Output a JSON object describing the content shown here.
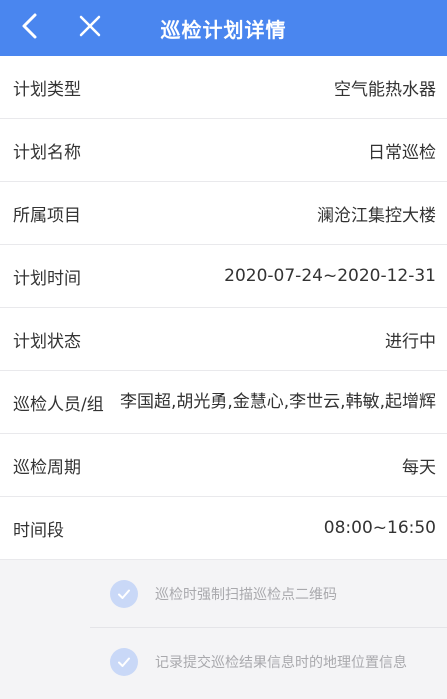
{
  "header": {
    "title": "巡检计划详情",
    "back_icon": "chevron-left-icon",
    "close_icon": "close-icon",
    "bg_color": "#4a86ef"
  },
  "details": [
    {
      "label": "计划类型",
      "value": "空气能热水器"
    },
    {
      "label": "计划名称",
      "value": "日常巡检"
    },
    {
      "label": "所属项目",
      "value": "澜沧江集控大楼"
    },
    {
      "label": "计划时间",
      "value": "2020-07-24~2020-12-31"
    },
    {
      "label": "计划状态",
      "value": "进行中"
    },
    {
      "label": "巡检人员/组",
      "value": "李国超,胡光勇,金慧心,李世云,韩敏,起增辉"
    },
    {
      "label": "巡检周期",
      "value": "每天"
    },
    {
      "label": "时间段",
      "value": "08:00~16:50"
    }
  ],
  "options": [
    {
      "text": "巡检时强制扫描巡检点二维码",
      "checked": true
    },
    {
      "text": "记录提交巡检结果信息时的地理位置信息",
      "checked": true
    }
  ]
}
